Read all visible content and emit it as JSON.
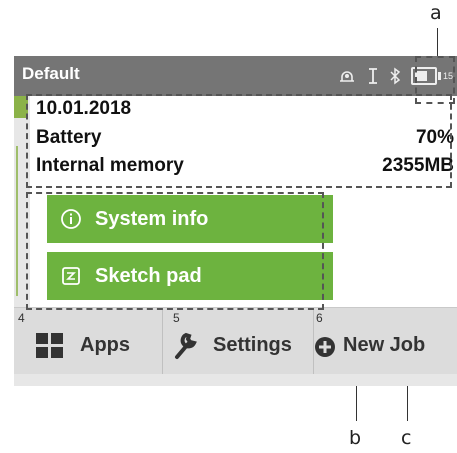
{
  "titlebar": {
    "title": "Default",
    "time_text": "15"
  },
  "popup": {
    "date": "10.01.2018",
    "battery_label": "Battery",
    "battery_value": "70%",
    "memory_label": "Internal memory",
    "memory_value": "2355MB"
  },
  "buttons": {
    "system_info": "System info",
    "sketch_pad": "Sketch pad"
  },
  "bottombar": {
    "items": [
      {
        "num": "4",
        "label": "Apps"
      },
      {
        "num": "5",
        "label": "Settings"
      },
      {
        "num": "6",
        "label": "New Job"
      }
    ]
  },
  "callouts": {
    "a": "a",
    "b": "b",
    "c": "c"
  },
  "colors": {
    "titlebar": "#757575",
    "button_green": "#6db33f",
    "bottombar": "#dcdcdc"
  }
}
